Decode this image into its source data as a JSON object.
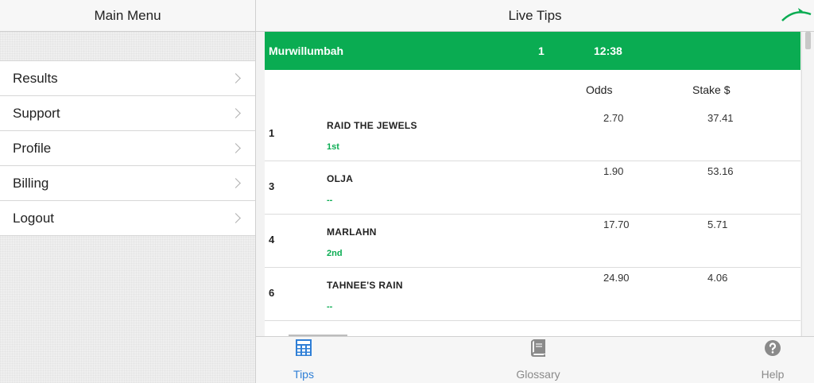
{
  "sidebar": {
    "title": "Main Menu",
    "items": [
      {
        "label": "Results"
      },
      {
        "label": "Support"
      },
      {
        "label": "Profile"
      },
      {
        "label": "Billing"
      },
      {
        "label": "Logout"
      }
    ]
  },
  "main": {
    "title": "Live Tips",
    "race": {
      "venue": "Murwillumbah",
      "number": "1",
      "time": "12:38"
    },
    "columns": {
      "odds": "Odds",
      "stake": "Stake $"
    },
    "runners": [
      {
        "number": "1",
        "name": "RAID THE JEWELS",
        "place": "1st",
        "odds": "2.70",
        "stake": "37.41"
      },
      {
        "number": "3",
        "name": "OLJA",
        "place": "--",
        "odds": "1.90",
        "stake": "53.16"
      },
      {
        "number": "4",
        "name": "MARLAHN",
        "place": "2nd",
        "odds": "17.70",
        "stake": "5.71"
      },
      {
        "number": "6",
        "name": "TAHNEE'S RAIN",
        "place": "--",
        "odds": "24.90",
        "stake": "4.06"
      }
    ]
  },
  "tabbar": {
    "tabs": [
      {
        "label": "Tips",
        "icon": "calculator-icon",
        "active": true
      },
      {
        "label": "Glossary",
        "icon": "book-icon",
        "active": false
      },
      {
        "label": "Help",
        "icon": "help-circle-icon",
        "active": false
      }
    ]
  },
  "colors": {
    "accent_green": "#0aac52",
    "active_tab_blue": "#2f7fd6",
    "inactive_tab": "#8a8a8a"
  }
}
